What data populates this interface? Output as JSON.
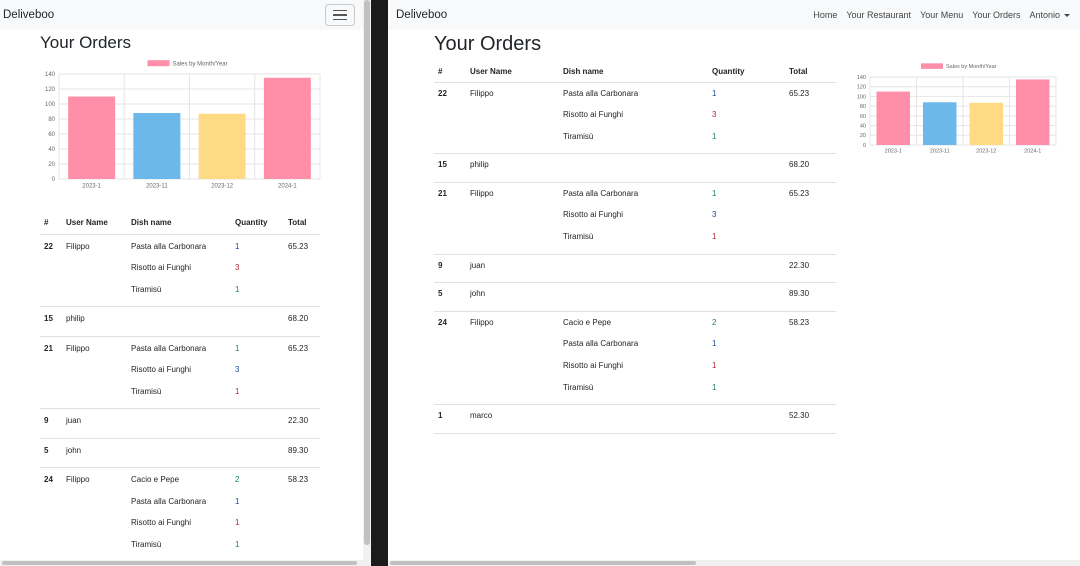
{
  "app": {
    "brand": "Deliveboo",
    "page_title": "Your Orders",
    "nav": [
      "Home",
      "Your Restaurant",
      "Your Menu",
      "Your Orders"
    ],
    "user": "Antonio"
  },
  "table": {
    "headers": [
      "#",
      "User Name",
      "Dish name",
      "Quantity",
      "Total"
    ],
    "orders": [
      {
        "id": "22",
        "user": "Filippo",
        "total": "65.23",
        "dishes": [
          {
            "name": "Pasta alla Carbonara",
            "qty": "1"
          },
          {
            "name": "Risotto ai Funghi",
            "qty": "3"
          },
          {
            "name": "Tiramisù",
            "qty": "1"
          }
        ]
      },
      {
        "id": "15",
        "user": "philip",
        "total": "68.20",
        "dishes": []
      },
      {
        "id": "21",
        "user": "Filippo",
        "total": "65.23",
        "dishes": [
          {
            "name": "Pasta alla Carbonara",
            "qty": "1"
          },
          {
            "name": "Risotto ai Funghi",
            "qty": "3"
          },
          {
            "name": "Tiramisù",
            "qty": "1"
          }
        ]
      },
      {
        "id": "9",
        "user": "juan",
        "total": "22.30",
        "dishes": []
      },
      {
        "id": "5",
        "user": "john",
        "total": "89.30",
        "dishes": []
      },
      {
        "id": "24",
        "user": "Filippo",
        "total": "58.23",
        "dishes": [
          {
            "name": "Cacio e Pepe",
            "qty": "2"
          },
          {
            "name": "Pasta alla Carbonara",
            "qty": "1"
          },
          {
            "name": "Risotto ai Funghi",
            "qty": "1"
          },
          {
            "name": "Tiramisù",
            "qty": "1"
          }
        ]
      },
      {
        "id": "1",
        "user": "marco",
        "total": "52.30",
        "dishes": []
      }
    ]
  },
  "chart_data": {
    "type": "bar",
    "categories": [
      "2023-1",
      "2023-11",
      "2023-12",
      "2024-1"
    ],
    "series": [
      {
        "name": "Sales by Month/Year",
        "values": [
          110,
          88,
          87,
          135
        ]
      }
    ],
    "ylim": [
      0,
      140
    ],
    "yticks": [
      0,
      20,
      40,
      60,
      80,
      100,
      120,
      140
    ],
    "bar_colors": [
      "#ff8fa8",
      "#6cb8ea",
      "#ffda84",
      "#ff8fa8"
    ],
    "legend_color": "#ff8fa8",
    "grid": true,
    "legend": "top"
  }
}
